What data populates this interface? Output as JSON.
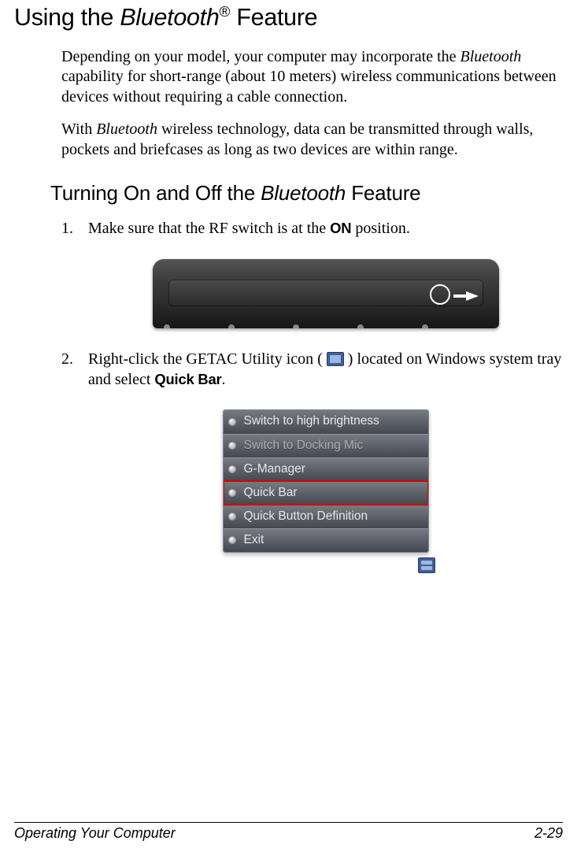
{
  "headings": {
    "h1_pre": "Using the ",
    "h1_italic": "Bluetooth",
    "h1_reg": "®",
    "h1_post": " Feature",
    "h2_pre": "Turning On and Off the ",
    "h2_italic": "Bluetooth",
    "h2_post": " Feature"
  },
  "paras": {
    "p1_pre": "Depending on your model, your computer may incorporate the ",
    "p1_italic": "Bluetooth",
    "p1_post": " capability for short-range (about 10 meters) wireless communications between devices without requiring a cable connection.",
    "p2_pre": "With ",
    "p2_italic": "Bluetooth",
    "p2_post": " wireless technology, data can be transmitted through walls, pockets and briefcases as long as two devices are within range."
  },
  "steps": {
    "s1_pre": "Make sure that the RF switch is at the ",
    "s1_bold": "ON",
    "s1_post": " position.",
    "s2_pre": "Right-click the GETAC Utility icon ( ",
    "s2_mid": " ) located on Windows system tray and select ",
    "s2_bold": "Quick Bar",
    "s2_post": "."
  },
  "menu": {
    "items": [
      {
        "label": "Switch to high brightness",
        "disabled": false,
        "highlight": false
      },
      {
        "label": "Switch to Docking Mic",
        "disabled": true,
        "highlight": false
      },
      {
        "label": "G-Manager",
        "disabled": false,
        "highlight": false
      },
      {
        "label": "Quick Bar",
        "disabled": false,
        "highlight": true
      },
      {
        "label": "Quick Button Definition",
        "disabled": false,
        "highlight": false
      },
      {
        "label": "Exit",
        "disabled": false,
        "highlight": false
      }
    ]
  },
  "footer": {
    "left": "Operating Your Computer",
    "right": "2-29"
  }
}
